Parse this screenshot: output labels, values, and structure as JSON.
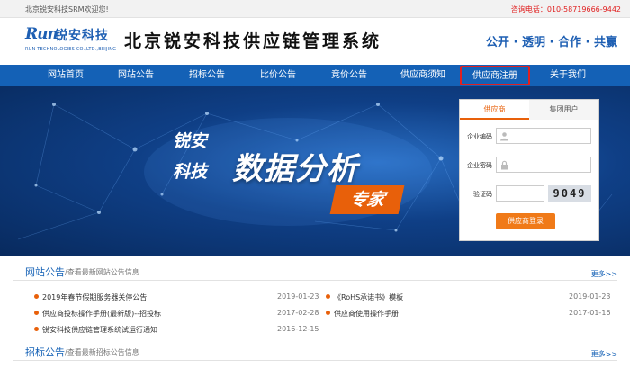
{
  "topbar": {
    "welcome": "北京锐安科技SRM欢迎您!",
    "phone": "咨询电话：010-58719666-9442"
  },
  "header": {
    "logo_mark": "Run",
    "logo_cn": "锐安科技",
    "logo_en": "RUN TECHNOLOGIES CO.,LTD.,BEIJING",
    "title": "北京锐安科技供应链管理系统",
    "slogan": "公开 · 透明 · 合作 · 共赢"
  },
  "nav": {
    "items": [
      {
        "label": "网站首页"
      },
      {
        "label": "网站公告"
      },
      {
        "label": "招标公告"
      },
      {
        "label": "比价公告"
      },
      {
        "label": "竞价公告"
      },
      {
        "label": "供应商须知"
      },
      {
        "label": "供应商注册"
      },
      {
        "label": "关于我们"
      }
    ],
    "highlight_color": "#e02020"
  },
  "banner": {
    "line1": "锐安",
    "line2": "科技",
    "headline": "数据分析",
    "tag": "专家"
  },
  "login": {
    "tabs": [
      {
        "label": "供应商"
      },
      {
        "label": "集团用户"
      }
    ],
    "company_code_label": "企业编码",
    "password_label": "企业密码",
    "captcha_label": "验证码",
    "captcha_text": "9049",
    "submit_label": "供应商登录",
    "accent": "#f07a18"
  },
  "site_notice": {
    "title": "网站公告",
    "subtitle": "/查看最新网站公告信息",
    "more": "更多>>",
    "left": [
      {
        "title": "2019年春节假期服务器关停公告",
        "date": "2019-01-23"
      },
      {
        "title": "供应商投标操作手册(最新版)--招投标",
        "date": "2017-02-28"
      },
      {
        "title": "锐安科技供应链管理系统试运行通知",
        "date": "2016-12-15"
      }
    ],
    "right": [
      {
        "title": "《RoHS承诺书》模板",
        "date": "2019-01-23"
      },
      {
        "title": "供应商使用操作手册",
        "date": "2017-01-16"
      }
    ]
  },
  "tender_notice": {
    "title": "招标公告",
    "subtitle": "/查看最新招标公告信息",
    "more": "更多>>"
  }
}
